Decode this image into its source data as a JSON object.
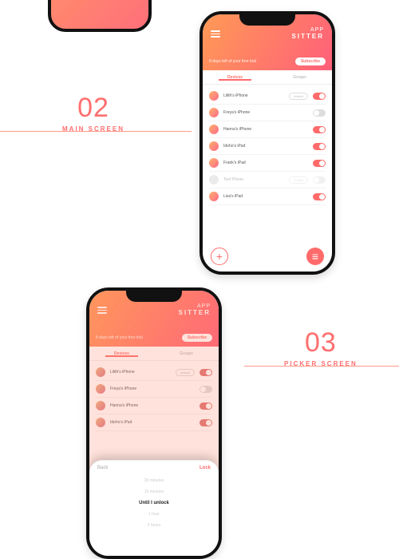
{
  "labels": {
    "s02": {
      "num": "02",
      "caption": "MAIN SCREEN"
    },
    "s03": {
      "num": "03",
      "caption": "PICKER SCREEN"
    }
  },
  "brand": {
    "line1": "APP",
    "line2": "SITTER"
  },
  "header": {
    "sub_text": "8 days left of your free trial",
    "subscribe": "Subscribe"
  },
  "tabs": {
    "devices": "Devices",
    "groups": "Groups"
  },
  "devices": [
    {
      "name": "Lilith's iPhone",
      "pill": "Unlock",
      "on": true,
      "gray": false
    },
    {
      "name": "Freya's iPhone",
      "pill": "",
      "on": false,
      "gray": false
    },
    {
      "name": "Hanna's iPhone",
      "pill": "",
      "on": true,
      "gray": false
    },
    {
      "name": "Idoho's iPad",
      "pill": "",
      "on": true,
      "gray": false
    },
    {
      "name": "Frank's iPad",
      "pill": "",
      "on": true,
      "gray": false
    },
    {
      "name": "Test Phone",
      "pill": "Delete",
      "on": false,
      "gray": true
    },
    {
      "name": "Lisa's iPad",
      "pill": "",
      "on": true,
      "gray": false
    }
  ],
  "fab": {
    "add": "+",
    "chat": "≡"
  },
  "sheet": {
    "back": "Back",
    "lock": "Lock",
    "options": [
      "30 minutes",
      "15 minutes",
      "Until I unlock",
      "1 hour",
      "2 hours"
    ],
    "selected": "Until I unlock"
  }
}
